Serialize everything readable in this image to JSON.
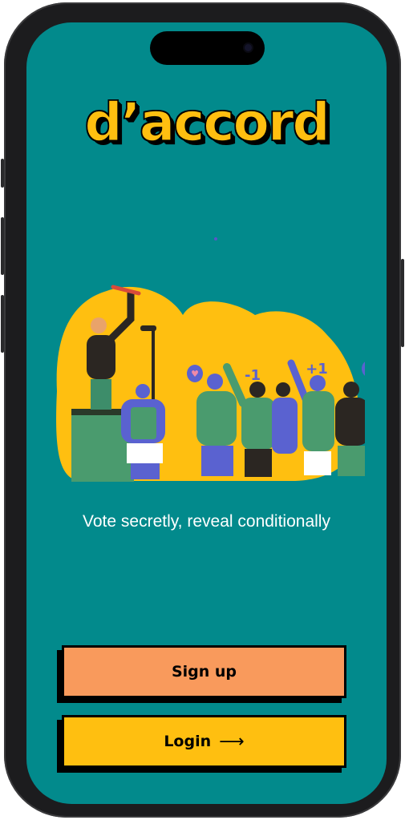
{
  "app": {
    "logo_text": "d’accord",
    "tagline": "Vote secretly, reveal conditionally"
  },
  "illustration": {
    "badges": [
      "-1",
      "+1"
    ]
  },
  "actions": {
    "signup_label": "Sign up",
    "login_label": "Login",
    "login_arrow": "⟶"
  },
  "colors": {
    "background": "#028a8c",
    "accent_yellow": "#ffbf10",
    "signup_orange": "#f99a5c",
    "text_light": "#ffffff"
  }
}
